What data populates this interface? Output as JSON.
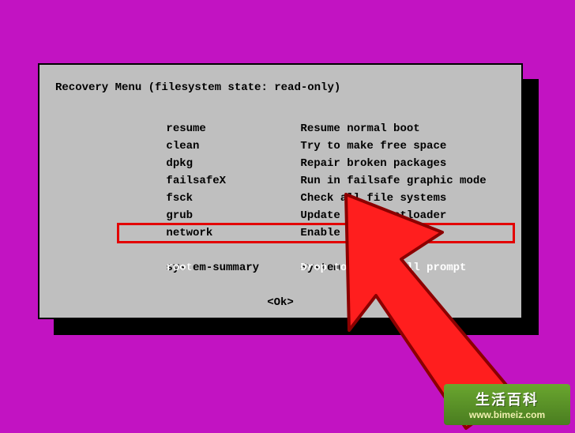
{
  "dialog": {
    "title": "Recovery Menu (filesystem state: read-only)",
    "items": [
      {
        "option": "resume",
        "desc": "Resume normal boot",
        "selected": false
      },
      {
        "option": "clean",
        "desc": "Try to make free space",
        "selected": false
      },
      {
        "option": "dpkg",
        "desc": "Repair broken packages",
        "selected": false
      },
      {
        "option": "failsafeX",
        "desc": "Run in failsafe graphic mode",
        "selected": false
      },
      {
        "option": "fsck",
        "desc": "Check all file systems",
        "selected": false
      },
      {
        "option": "grub",
        "desc": "Update grub bootloader",
        "selected": false
      },
      {
        "option": "network",
        "desc": "Enable networking",
        "selected": false
      },
      {
        "option": "root",
        "desc": "Drop to root shell prompt",
        "selected": true
      },
      {
        "option": "system-summary",
        "desc": "System summary",
        "selected": false
      }
    ],
    "ok_label": "<Ok>"
  },
  "cursor": {
    "fill": "#ff1e1e",
    "stroke": "#8b0000"
  },
  "watermark": {
    "title": "生活百科",
    "url": "www.bimeiz.com"
  }
}
